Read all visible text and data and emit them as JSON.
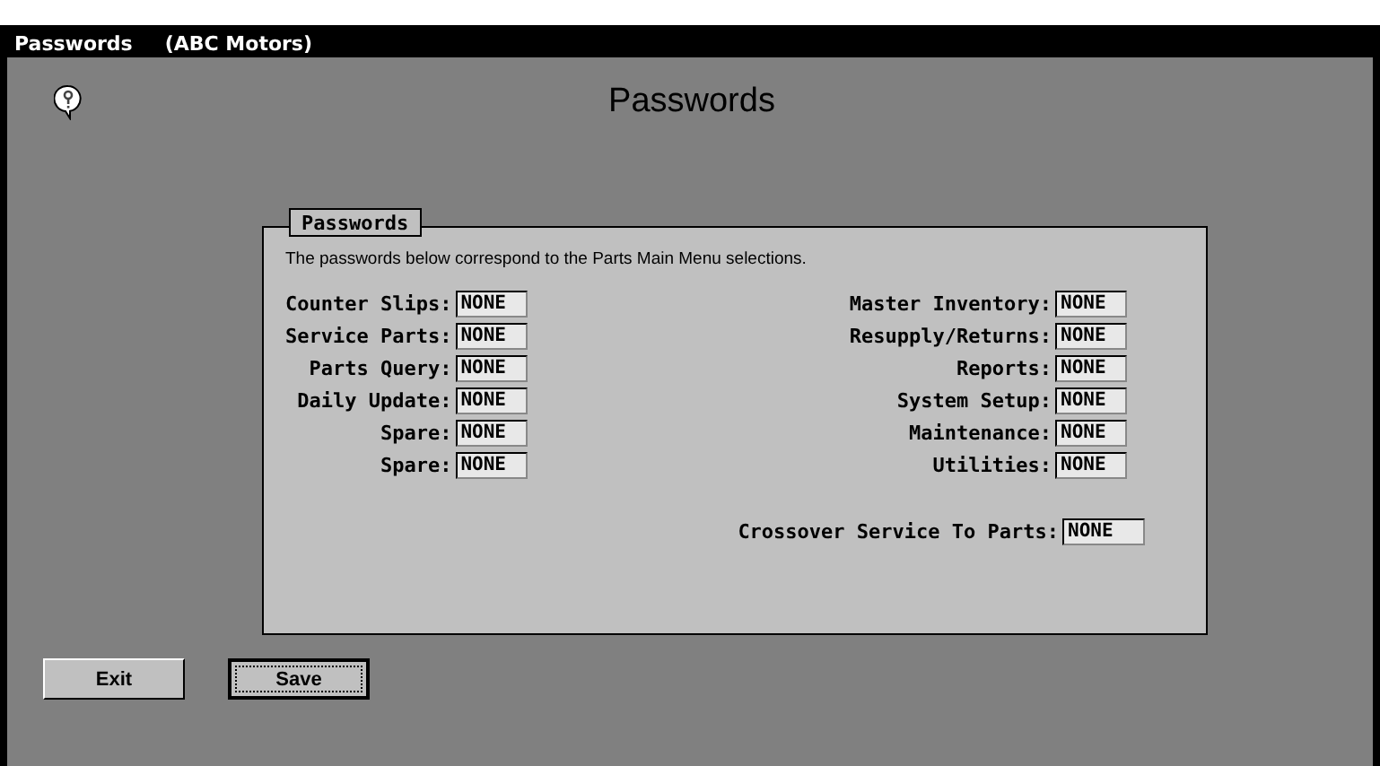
{
  "window": {
    "title": "Passwords",
    "subtitle": "(ABC Motors)"
  },
  "heading": "Passwords",
  "group": {
    "title": "Passwords",
    "description": "The passwords below correspond to the Parts Main Menu selections.",
    "left_fields": [
      {
        "label": "Counter Slips:",
        "value": "NONE"
      },
      {
        "label": "Service Parts:",
        "value": "NONE"
      },
      {
        "label": "Parts Query:",
        "value": "NONE"
      },
      {
        "label": "Daily Update:",
        "value": "NONE"
      },
      {
        "label": "Spare:",
        "value": "NONE"
      },
      {
        "label": "Spare:",
        "value": "NONE"
      }
    ],
    "right_fields": [
      {
        "label": "Master Inventory:",
        "value": "NONE"
      },
      {
        "label": "Resupply/Returns:",
        "value": "NONE"
      },
      {
        "label": "Reports:",
        "value": "NONE"
      },
      {
        "label": "System Setup:",
        "value": "NONE"
      },
      {
        "label": "Maintenance:",
        "value": "NONE"
      },
      {
        "label": "Utilities:",
        "value": "NONE"
      }
    ],
    "crossover": {
      "label": "Crossover Service To Parts:",
      "value": "NONE"
    }
  },
  "buttons": [
    {
      "label": "Exit",
      "focused": false
    },
    {
      "label": "Save",
      "focused": true
    }
  ]
}
